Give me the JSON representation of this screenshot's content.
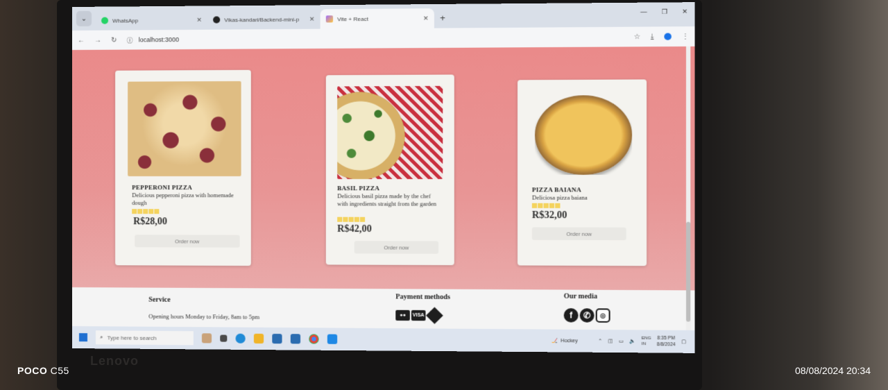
{
  "browser": {
    "tabs": [
      {
        "title": "WhatsApp",
        "icon": "whatsapp-icon"
      },
      {
        "title": "Vikas-kandari/Backend-mini-p",
        "icon": "github-icon"
      },
      {
        "title": "Vite + React",
        "icon": "vite-icon",
        "active": true
      }
    ],
    "new_tab": "+",
    "url": "localhost:3000"
  },
  "products": [
    {
      "name": "PEPPERONI PIZZA",
      "description": "Delicious pepperoni pizza with homemade dough",
      "price": "R$28,00",
      "rating": 5,
      "button": "Order now"
    },
    {
      "name": "BASIL PIZZA",
      "description": "Delicious basil pizza made by the chef with ingredients straight from the garden",
      "price": "R$42,00",
      "rating": 5,
      "button": "Order now"
    },
    {
      "name": "PIZZA BAIANA",
      "description": "Deliciosa pizza baiana",
      "price": "R$32,00",
      "rating": 5,
      "button": "Order now"
    }
  ],
  "footer": {
    "service_title": "Service",
    "service_hours": "Opening hours  Monday to Friday, 8am to 5pm",
    "payment_title": "Payment methods",
    "payment_icons": [
      "mastercard-icon",
      "visa-icon",
      "pix-icon"
    ],
    "media_title": "Our media",
    "media_icons": [
      "facebook-icon",
      "whatsapp-icon",
      "instagram-icon"
    ]
  },
  "taskbar": {
    "search_placeholder": "Type here to search",
    "weather_label": "Hockey",
    "lang": "ENG\nIN",
    "time": "8:35 PM",
    "date": "8/8/2024"
  },
  "photo_overlay": {
    "device_brand": "POCO",
    "device_model": "C55",
    "timestamp": "08/08/2024  20:34"
  },
  "laptop": {
    "brand": "Lenovo"
  },
  "colors": {
    "hero_bg": "#ea8a8a",
    "card_bg": "#f4f3ef",
    "star": "#f4d35e"
  }
}
